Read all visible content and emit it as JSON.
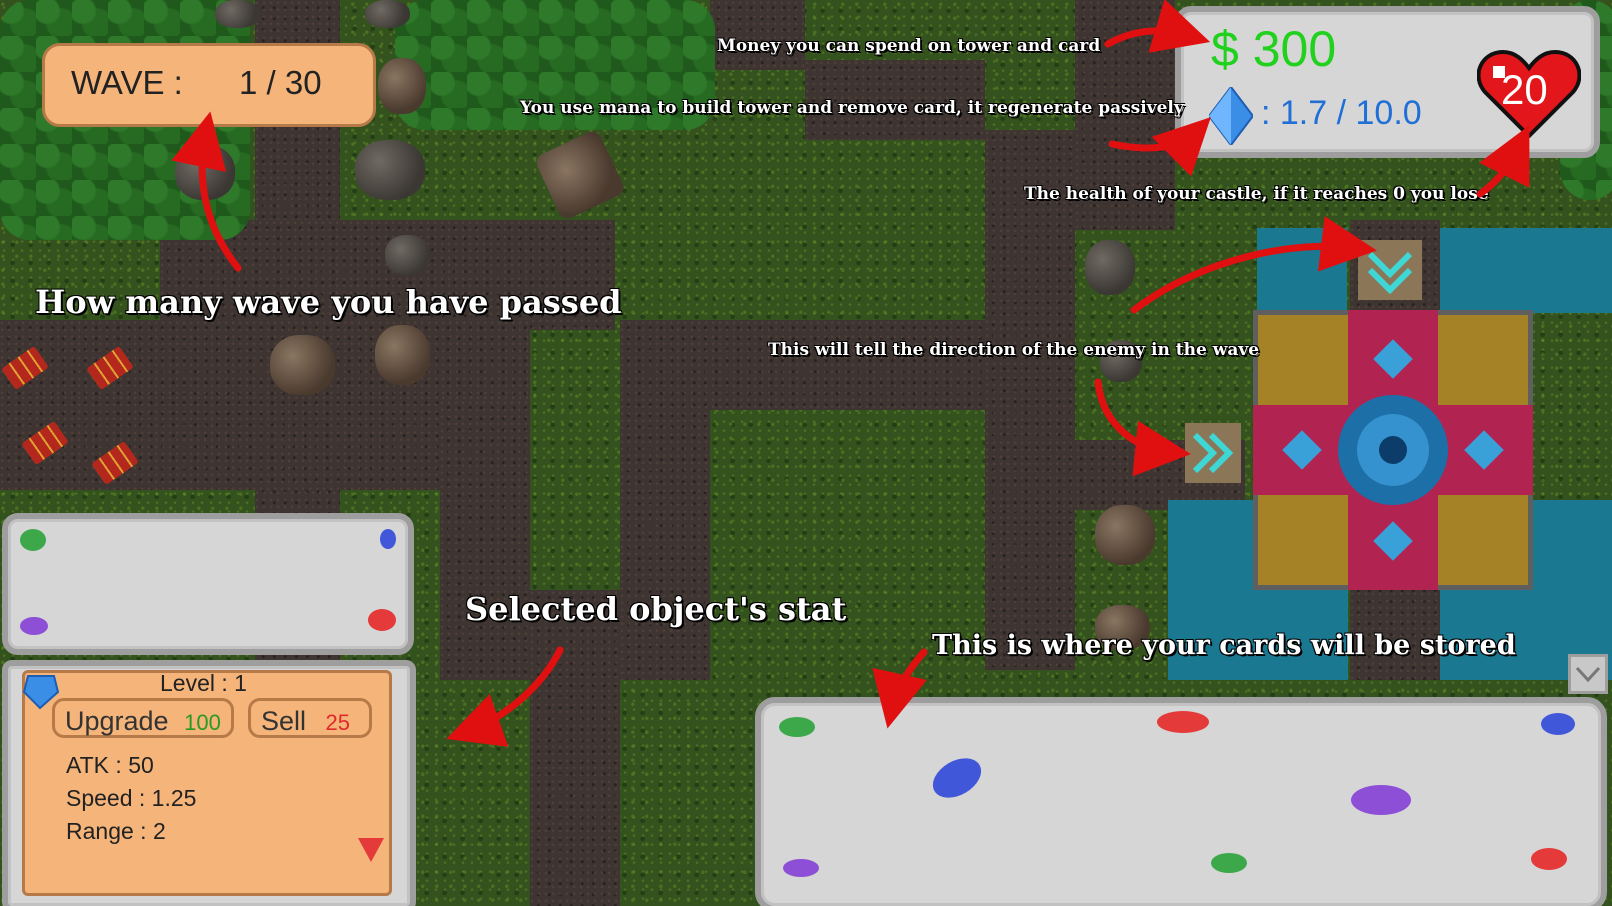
{
  "hud": {
    "wave_label": "WAVE :",
    "wave_value": "1 / 30",
    "money": "$ 300",
    "mana": ": 1.7 / 10.0",
    "health": "20"
  },
  "annotations": {
    "money": "Money you can spend on tower and card",
    "mana": "You use mana to build tower and remove card, it regenerate passively",
    "health": "The health of your castle, if it reaches 0 you lose",
    "wave": "How many wave you have passed",
    "direction": "This will tell the direction of the enemy in the wave",
    "stats": "Selected object's stat",
    "cards": "This is where your cards will be stored"
  },
  "selected": {
    "level": "Level : 1",
    "upgrade_label": "Upgrade",
    "upgrade_cost": "100",
    "sell_label": "Sell",
    "sell_value": "25",
    "atk": "ATK : 50",
    "speed": "Speed : 1.25",
    "range": "Range : 2"
  },
  "colors": {
    "money": "#22d11e",
    "mana": "#1f6fd6",
    "upgrade_cost": "#2a9a20",
    "sell_value": "#e02b2b",
    "arrow": "#e01010",
    "direction_chevron": "#3fd6d6"
  },
  "icons": [
    "mana-crystal-icon",
    "heart-icon",
    "chevron-down-icon",
    "chevron-right-icon",
    "dropdown-arrow-icon"
  ]
}
